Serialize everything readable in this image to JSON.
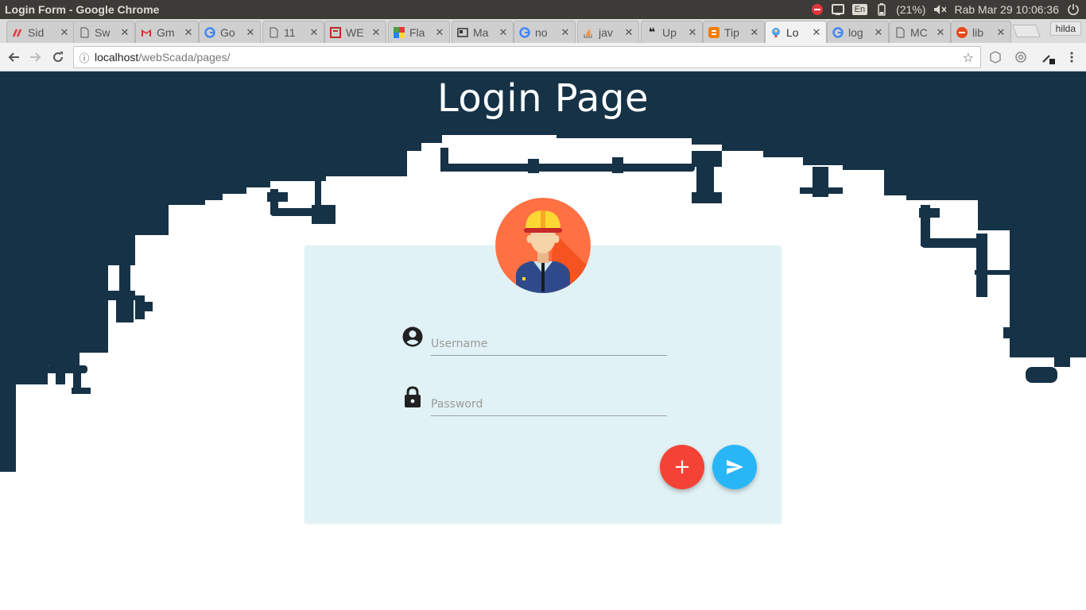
{
  "window": {
    "title": "Login Form - Google Chrome"
  },
  "system_tray": {
    "language": "En",
    "battery": "(21%)",
    "clock": "Rab Mar 29 10:06:36",
    "icons": [
      "record-stop-icon",
      "cast-icon",
      "keyboard-language-icon",
      "battery-icon",
      "volume-muted-icon",
      "power-icon"
    ]
  },
  "tabs": [
    {
      "label": "Sid",
      "favicon": "pinterest-like-icon",
      "active": false
    },
    {
      "label": "Sw",
      "favicon": "page-icon",
      "active": false
    },
    {
      "label": "Gm",
      "favicon": "gmail-icon",
      "active": false
    },
    {
      "label": "Go",
      "favicon": "google-icon",
      "active": false
    },
    {
      "label": "11",
      "favicon": "page-icon",
      "active": false
    },
    {
      "label": "WE",
      "favicon": "web-icon",
      "active": false
    },
    {
      "label": "Fla",
      "favicon": "flat-icon",
      "active": false
    },
    {
      "label": "Ma",
      "favicon": "news-icon",
      "active": false
    },
    {
      "label": "no",
      "favicon": "google-icon",
      "active": false
    },
    {
      "label": "jav",
      "favicon": "stackoverflow-icon",
      "active": false
    },
    {
      "label": "Up",
      "favicon": "quote-icon",
      "active": false
    },
    {
      "label": "Tip",
      "favicon": "blogger-icon",
      "active": false
    },
    {
      "label": "Lo",
      "favicon": "login-favicon",
      "active": true
    },
    {
      "label": "log",
      "favicon": "google-icon",
      "active": false
    },
    {
      "label": "MC",
      "favicon": "page-icon",
      "active": false
    },
    {
      "label": "lib",
      "favicon": "ask-icon",
      "active": false
    }
  ],
  "profile": {
    "name": "hilda"
  },
  "address_bar": {
    "host": "localhost",
    "path": "/webScada/pages/"
  },
  "page": {
    "title": "Login Page",
    "username_placeholder": "Username",
    "password_placeholder": "Password",
    "add_button_label": "+"
  },
  "colors": {
    "navy": "#163247",
    "card_bg": "#e0f2f5",
    "add_button": "#f44336",
    "send_button": "#29b6f6",
    "avatar_bg": "#ff7043"
  }
}
